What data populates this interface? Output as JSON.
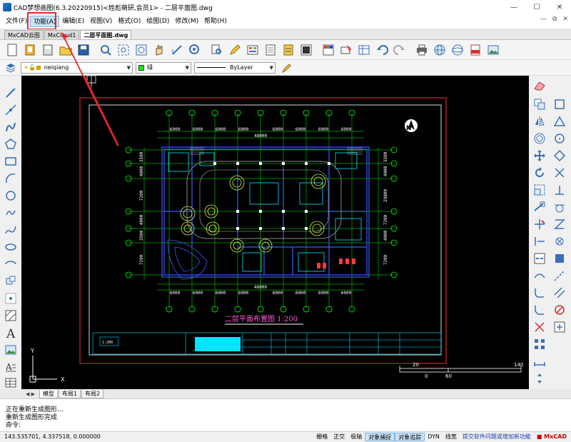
{
  "window": {
    "title": "CAD梦想画图(6.3.20220915)<姓彪萌研,会员1> - 二层平面图.dwg"
  },
  "menu": {
    "items": [
      "文件(F)",
      "功能(A)",
      "编辑(E)",
      "视图(V)",
      "格式(O)",
      "绘图(D)",
      "修改(M)",
      "帮助(H)"
    ],
    "active_index": 1
  },
  "doc_tabs": [
    "MxCAD云图",
    "MxCloud1",
    "二层平面图.dwg"
  ],
  "active_doc_tab": 2,
  "toolbar2": {
    "layer": "neiqiang",
    "color": "绿",
    "linetype": "ByLayer"
  },
  "drawing": {
    "title": "二层平面布置图   1:200",
    "dim_top": [
      "6000",
      "6000",
      "6000",
      "6000",
      "6000",
      "6000",
      "6000",
      "6000"
    ],
    "dim_top_total": "48000",
    "dim_bottom": [
      "6000",
      "6000",
      "6000",
      "6000",
      "6000",
      "6000",
      "6000",
      "6000"
    ],
    "dim_bottom_total": "48000",
    "dim_left": [
      "3500",
      "4000",
      "7200",
      "4000",
      "3500",
      "7200"
    ],
    "dim_right": [
      "3500",
      "4000",
      "29800",
      "7200",
      "4000",
      "7200"
    ],
    "north_label": "N",
    "ucs_x": "X",
    "ucs_y": "Y",
    "scale_top": [
      "20",
      "140"
    ],
    "scale_bottom": [
      "0",
      "60"
    ],
    "stamp_label": "1:200"
  },
  "layout_tabs": [
    "模型",
    "布局1",
    "布局2"
  ],
  "command_lines": [
    "正在重新生成图形...",
    "重新生成图形完成",
    "命令:"
  ],
  "status": {
    "coords": "143.535701,  4.337518,  0.000000",
    "toggles": [
      "栅格",
      "正交",
      "极轴",
      "对象捕捉",
      "对象追踪",
      "DYN",
      "线宽"
    ],
    "on": [
      3,
      4
    ],
    "link": "提交软件问题或增加新功能",
    "brand": "MxCAD"
  }
}
